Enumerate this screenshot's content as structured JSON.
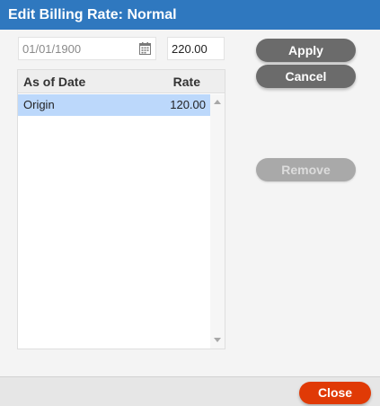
{
  "dialog": {
    "title": "Edit Billing Rate: Normal"
  },
  "form": {
    "date_value": "01/01/1900",
    "date_icon": "calendar-icon",
    "rate_value": "220.00"
  },
  "actions": {
    "apply_label": "Apply",
    "cancel_label": "Cancel",
    "remove_label": "Remove"
  },
  "grid": {
    "columns": [
      "As of Date",
      "Rate"
    ],
    "rows": [
      {
        "as_of_date": "Origin",
        "rate": "120.00",
        "selected": true
      }
    ]
  },
  "footer": {
    "close_label": "Close"
  },
  "colors": {
    "titlebar": "#2f78bf",
    "selected_row": "#bcd8fb",
    "primary_button": "#6b6b6b",
    "disabled_button": "#a9a9a9",
    "close_button": "#e03a06"
  }
}
